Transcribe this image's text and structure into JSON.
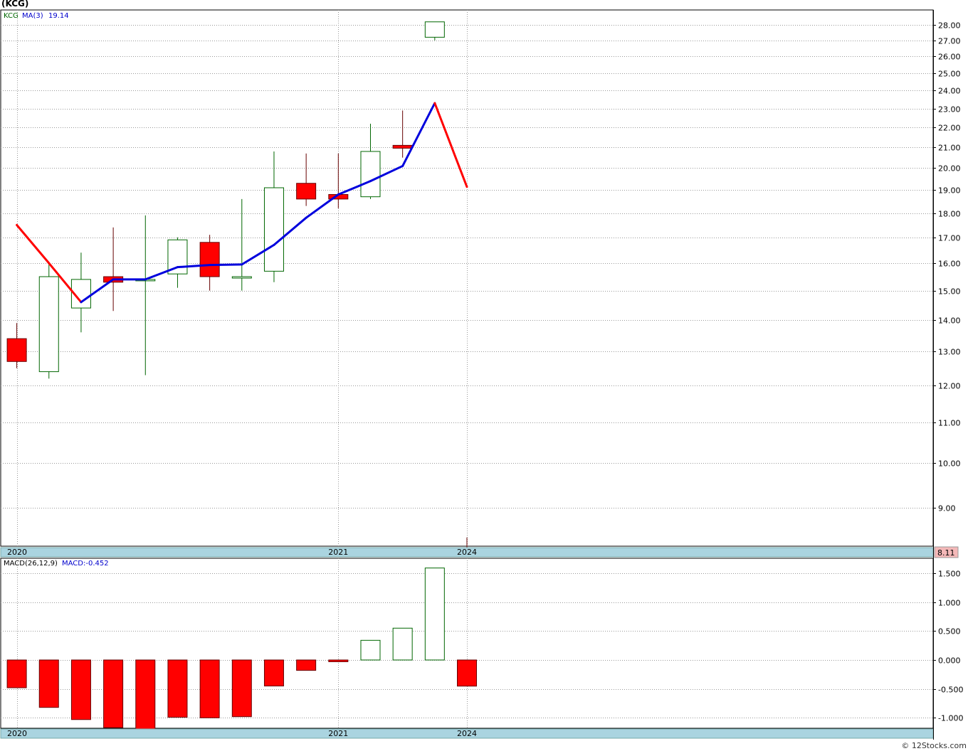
{
  "header": {
    "title": "(KCG)"
  },
  "price_panel": {
    "legend_symbol": "KCG",
    "ma_label": "MA(3)",
    "ma_value": "19.14",
    "last_price": "8.11",
    "y_ticks": [
      "28.00",
      "27.00",
      "26.00",
      "25.00",
      "24.00",
      "23.00",
      "22.00",
      "21.00",
      "20.00",
      "19.00",
      "18.00",
      "17.00",
      "16.00",
      "15.00",
      "14.00",
      "13.00",
      "12.00",
      "11.00",
      "10.00",
      "9.00"
    ],
    "x_labels": [
      "2020",
      "2021",
      "2024"
    ]
  },
  "macd_panel": {
    "label": "MACD(26,12,9)",
    "value_label": "MACD:-0.452",
    "y_ticks": [
      "1.500",
      "1.000",
      "0.500",
      "0.000",
      "-0.500",
      "-1.000"
    ],
    "x_labels": [
      "2020",
      "2021",
      "2024"
    ]
  },
  "footer": {
    "copyright": "© 12Stocks.com"
  },
  "colors": {
    "up": "#006600",
    "down": "#ff0000",
    "ma_line": "#0000dd",
    "ma_line_down": "#ff0000",
    "axis_band": "#aad4e0",
    "last_price_badge": "#f4b8b8"
  },
  "chart_data": [
    {
      "type": "candlestick",
      "title": "(KCG)",
      "y_scale": "log",
      "ylim": [
        8.0,
        28.6
      ],
      "series": [
        {
          "name": "KCG",
          "candles": [
            {
              "open": 13.4,
              "high": 13.9,
              "low": 12.5,
              "close": 12.7
            },
            {
              "open": 12.4,
              "high": 16.0,
              "low": 12.2,
              "close": 15.5
            },
            {
              "open": 14.4,
              "high": 16.4,
              "low": 13.6,
              "close": 15.4
            },
            {
              "open": 15.5,
              "high": 17.4,
              "low": 14.3,
              "close": 15.3
            },
            {
              "open": 15.4,
              "high": 17.9,
              "low": 12.3,
              "close": 15.4
            },
            {
              "open": 15.6,
              "high": 17.0,
              "low": 15.1,
              "close": 16.9
            },
            {
              "open": 16.8,
              "high": 17.1,
              "low": 15.0,
              "close": 15.5
            },
            {
              "open": 15.5,
              "high": 18.6,
              "low": 15.0,
              "close": 15.5
            },
            {
              "open": 15.7,
              "high": 20.8,
              "low": 15.3,
              "close": 19.1
            },
            {
              "open": 19.3,
              "high": 20.7,
              "low": 18.3,
              "close": 18.6
            },
            {
              "open": 18.8,
              "high": 20.7,
              "low": 18.2,
              "close": 18.6
            },
            {
              "open": 18.7,
              "high": 22.2,
              "low": 18.6,
              "close": 20.8
            },
            {
              "open": 21.1,
              "high": 22.9,
              "low": 20.5,
              "close": 21.0
            },
            {
              "open": 27.2,
              "high": 28.2,
              "low": 27.0,
              "close": 28.2
            },
            {
              "open": 8.2,
              "high": 8.4,
              "low": 8.1,
              "close": 8.11
            }
          ]
        },
        {
          "name": "MA(3)",
          "values": [
            17.5,
            16.0,
            14.6,
            15.4,
            15.4,
            15.85,
            15.93,
            15.95,
            16.7,
            17.8,
            18.8,
            19.4,
            20.1,
            23.3,
            19.14
          ]
        }
      ],
      "x_labels": [
        {
          "index": 0,
          "label": "2020"
        },
        {
          "index": 10,
          "label": "2021"
        },
        {
          "index": 14,
          "label": "2024"
        }
      ]
    },
    {
      "type": "bar",
      "title": "MACD(26,12,9)",
      "ylim": [
        -1.2,
        1.7
      ],
      "values": [
        -0.48,
        -0.82,
        -1.03,
        -1.17,
        -1.2,
        -0.99,
        -1.0,
        -0.98,
        -0.45,
        -0.18,
        -0.03,
        0.34,
        0.55,
        1.59,
        -0.452
      ],
      "x_labels": [
        {
          "index": 0,
          "label": "2020"
        },
        {
          "index": 10,
          "label": "2021"
        },
        {
          "index": 14,
          "label": "2024"
        }
      ]
    }
  ]
}
